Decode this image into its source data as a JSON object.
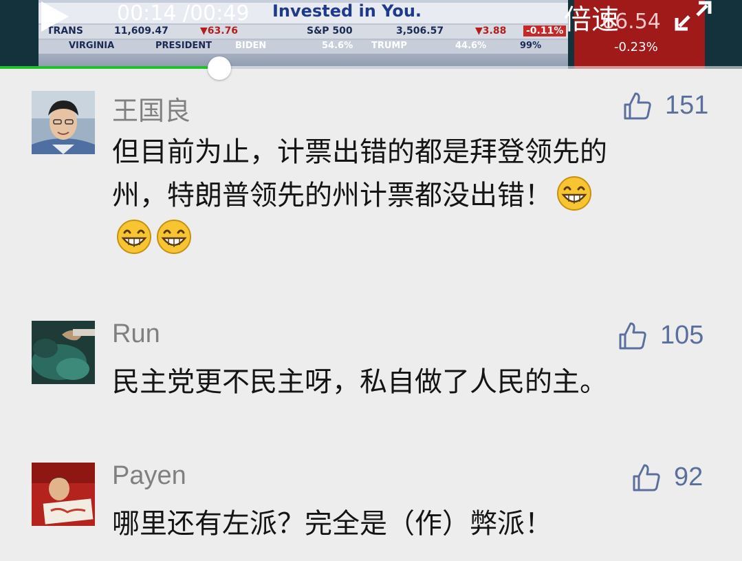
{
  "player": {
    "time": "00:14 /00:49",
    "speed_label": "倍速",
    "progress": 0.296,
    "broadcast": {
      "brand": "Invested in You.",
      "row1": [
        "TRANS",
        "11,609.47",
        "▼63.76",
        "S&P 500",
        "3,506.57",
        "▼3.88",
        "-0.11%"
      ],
      "row2": [
        "VIRGINIA",
        "PRESIDENT",
        "BIDEN",
        "54.6%",
        "TRUMP",
        "44.6%",
        "99%"
      ],
      "side_value": "66.54",
      "side_change": "-0.23%"
    }
  },
  "comments": [
    {
      "name": "王国良",
      "likes": "151",
      "lines": [
        "但目前为止，计票出错的都是拜登领先的",
        "州，特朗普领先的州计票都没出错！",
        ""
      ],
      "emojis_line2": 1,
      "emojis_line3": 2
    },
    {
      "name": "Run",
      "likes": "105",
      "lines": [
        "民主党更不民主呀，私自做了人民的主。"
      ]
    },
    {
      "name": "Payen",
      "likes": "92",
      "lines": [
        "哪里还有左派？完全是（作）弊派！"
      ]
    }
  ],
  "colors": {
    "page_bg": "#ededed",
    "name_gray": "#808080",
    "like_blue": "#5a6f9c",
    "progress_green": "#21c12e"
  }
}
